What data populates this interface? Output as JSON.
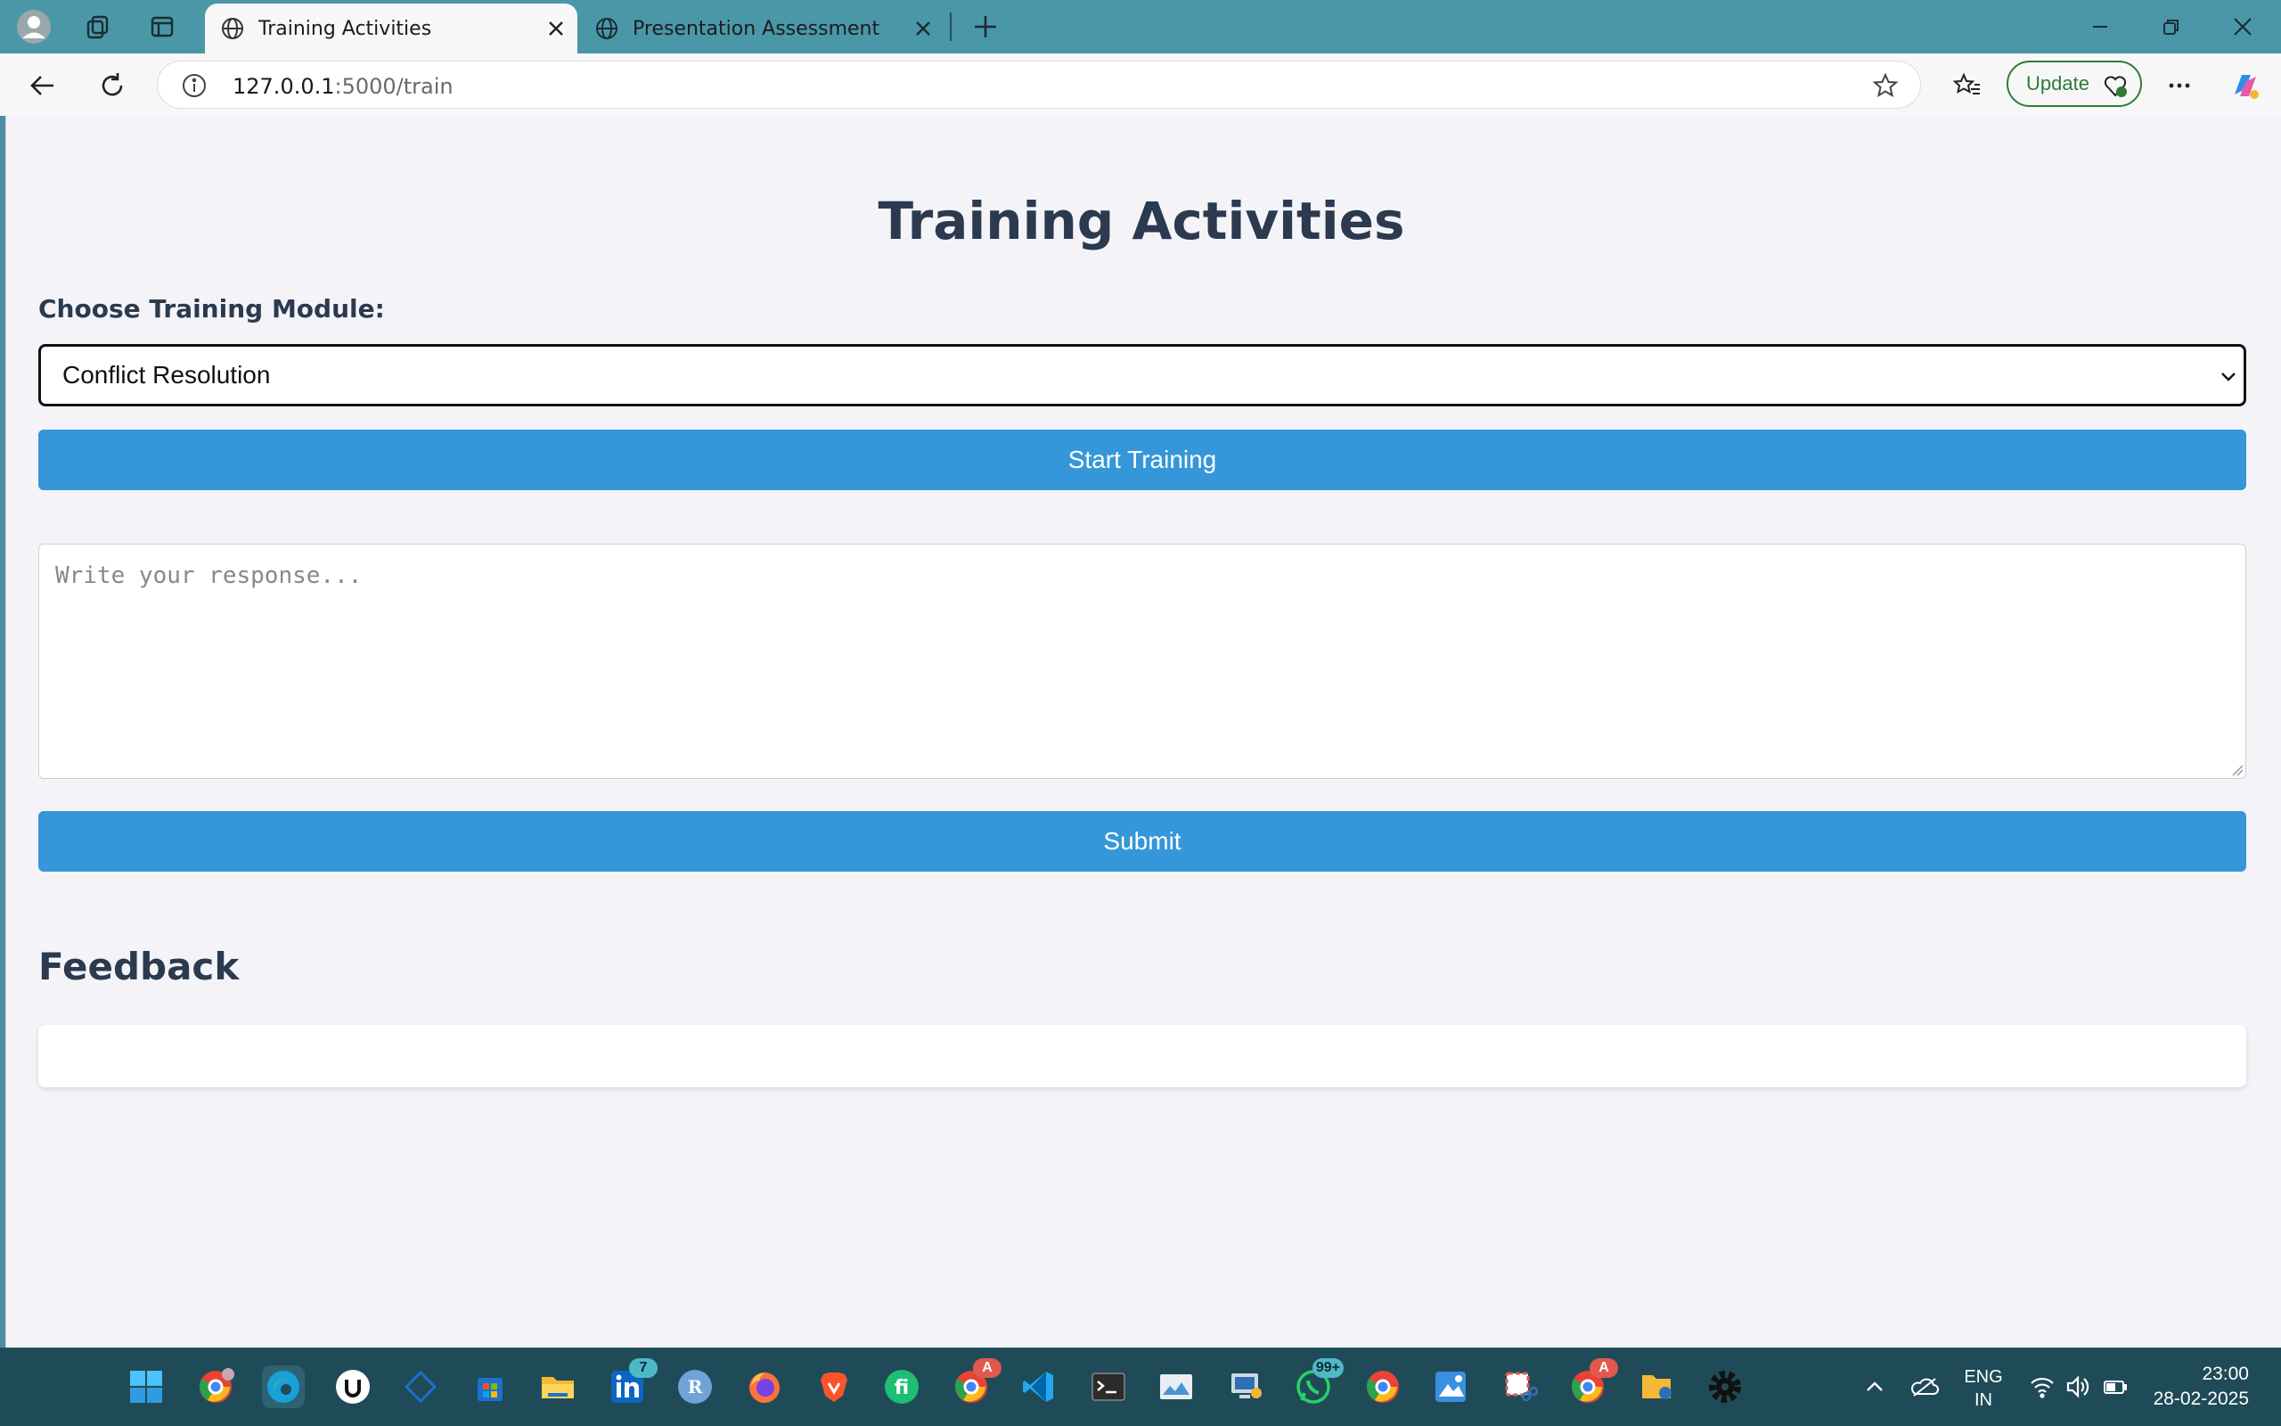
{
  "browser": {
    "tabs": [
      {
        "title": "Training Activities",
        "active": true
      },
      {
        "title": "Presentation Assessment",
        "active": false
      }
    ],
    "address": {
      "host": "127.0.0.1",
      "path": ":5000/train"
    },
    "update_label": "Update"
  },
  "page": {
    "title": "Training Activities",
    "module_label": "Choose Training Module:",
    "module_selected": "Conflict Resolution",
    "start_button": "Start Training",
    "response_placeholder": "Write your response...",
    "submit_button": "Submit",
    "feedback_heading": "Feedback",
    "feedback_text": ""
  },
  "taskbar": {
    "apps": [
      "windows-start",
      "chrome-profile",
      "edge",
      "udemy",
      "vscode-alt",
      "microsoft-store",
      "file-explorer",
      "linkedin",
      "r-app",
      "firefox",
      "brave",
      "fiverr",
      "chrome-a",
      "vscode",
      "terminal",
      "photos",
      "network-app",
      "whatsapp",
      "chrome",
      "paint",
      "snipping-tool",
      "chrome-b",
      "file-manager",
      "settings"
    ],
    "linkedin_badge": "7",
    "whatsapp_badge": "99+",
    "chrome_badge_1": "A",
    "chrome_badge_2": "A",
    "lang_line1": "ENG",
    "lang_line2": "IN",
    "time": "23:00",
    "date": "28-02-2025"
  },
  "colors": {
    "accent": "#3597d9",
    "heading": "#2b3a4e",
    "tabbar": "#4a97a8",
    "taskbar": "#1f4b58"
  }
}
